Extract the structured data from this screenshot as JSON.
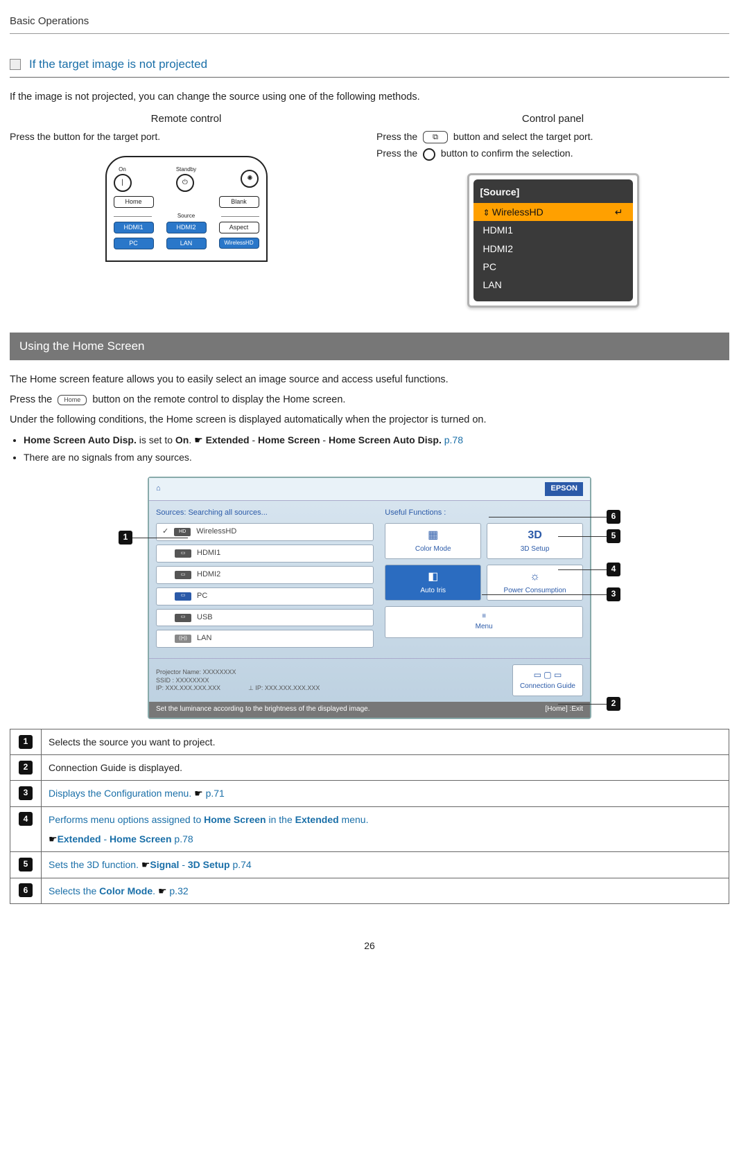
{
  "header": "Basic Operations",
  "section1": {
    "title": "If the target image is not projected",
    "intro": "If the image is not projected, you can change the source using one of the following methods.",
    "remote": {
      "title": "Remote control",
      "text": "Press the button for the target port.",
      "labels": {
        "on": "On",
        "standby": "Standby",
        "home": "Home",
        "blank": "Blank",
        "source": "Source",
        "hdmi1": "HDMI1",
        "hdmi2": "HDMI2",
        "aspect": "Aspect",
        "pc": "PC",
        "lan": "LAN",
        "whd": "WirelessHD"
      }
    },
    "panel": {
      "title": "Control panel",
      "line1a": "Press the",
      "line1b": "button and select the target port.",
      "line2a": "Press the",
      "line2b": "button to confirm the selection.",
      "osd": {
        "title": "[Source]",
        "items": [
          "WirelessHD",
          "HDMI1",
          "HDMI2",
          "PC",
          "LAN"
        ],
        "enter": "↵"
      }
    }
  },
  "section2": {
    "bar": "Using the Home Screen",
    "p1": "The Home screen feature allows you to easily select an image source and access useful functions.",
    "p2a": "Press the",
    "p2key": "Home",
    "p2b": "button on the remote control to display the Home screen.",
    "p3": "Under the following conditions, the Home screen is displayed automatically when the projector is turned on.",
    "bullets": {
      "b1a": "Home Screen Auto Disp.",
      "b1b": " is set to ",
      "b1c": "On",
      "b1d": ". ",
      "b1e": "Extended",
      "b1f": " - ",
      "b1g": "Home Screen",
      "b1h": " - ",
      "b1i": "Home Screen Auto Disp.",
      "b1link": "p.78",
      "b2": "There are no signals from any sources."
    },
    "fig": {
      "brand": "EPSON",
      "sourcesLabel": "Sources:  Searching all sources...",
      "usefulLabel": "Useful Functions :",
      "sources": [
        "WirelessHD",
        "HDMI1",
        "HDMI2",
        "PC",
        "USB",
        "LAN"
      ],
      "funcs": {
        "colorMode": "Color Mode",
        "threeD": "3D Setup",
        "autoIris": "Auto Iris",
        "power": "Power Consumption",
        "menu": "Menu"
      },
      "proj": {
        "name": "Projector Name:  XXXXXXXX",
        "ssid": "SSID :  XXXXXXXX",
        "ip1": "IP:  XXX.XXX.XXX.XXX",
        "ip2": "IP:  XXX.XXX.XXX.XXX"
      },
      "cg": "Connection Guide",
      "footerL": "Set the luminance according to the brightness of the displayed image.",
      "footerR": "[Home]  :Exit"
    },
    "table": {
      "r1": "Selects the source you want to project.",
      "r2": "Connection Guide is displayed.",
      "r3a": "Displays the Configuration menu. ",
      "r3link": "p.71",
      "r4a": "Performs menu options assigned to ",
      "r4b": "Home Screen",
      "r4c": " in the ",
      "r4d": "Extended",
      "r4e": " menu.",
      "r4f": "Extended",
      "r4g": " - ",
      "r4h": "Home Screen",
      "r4link": "p.78",
      "r5a": "Sets the 3D function. ",
      "r5b": "Signal",
      "r5c": " - ",
      "r5d": "3D Setup",
      "r5link": "p.74",
      "r6a": "Selects the ",
      "r6b": "Color Mode",
      "r6c": ". ",
      "r6link": "p.32"
    }
  },
  "pageNumber": "26"
}
